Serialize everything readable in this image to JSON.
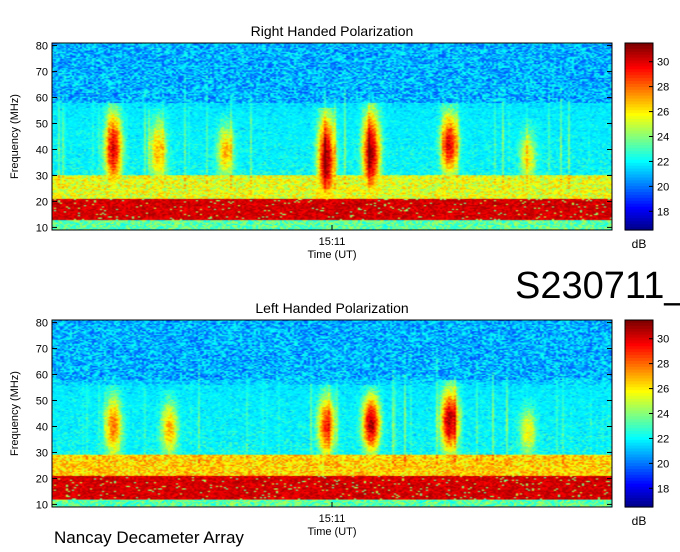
{
  "figure_id": "S230711_",
  "footer": "Nancay Decameter Array",
  "chart_data": [
    {
      "type": "heatmap",
      "title": "Right Handed Polarization",
      "xlabel": "Time (UT)",
      "ylabel": "Frequency (MHz)",
      "x_ticks": [
        "15:11"
      ],
      "ylim": [
        9,
        81
      ],
      "y_ticks": [
        10,
        20,
        30,
        40,
        50,
        60,
        70,
        80
      ],
      "colorbar": {
        "label": "dB",
        "range": [
          16.5,
          31.5
        ],
        "ticks": [
          18,
          20,
          22,
          24,
          26,
          28,
          30
        ],
        "colormap": "jet"
      },
      "features": {
        "background_db": 21,
        "band_strong": {
          "freq": [
            13,
            21
          ],
          "db": 31
        },
        "band_moderate": {
          "freq": [
            21,
            30
          ],
          "db": 26
        },
        "bursts": [
          {
            "t": 0.11,
            "f": [
              28,
              52
            ],
            "db": 30
          },
          {
            "t": 0.19,
            "f": [
              28,
              50
            ],
            "db": 27
          },
          {
            "t": 0.31,
            "f": [
              30,
              48
            ],
            "db": 27
          },
          {
            "t": 0.49,
            "f": [
              22,
              50
            ],
            "db": 31
          },
          {
            "t": 0.57,
            "f": [
              25,
              52
            ],
            "db": 31
          },
          {
            "t": 0.71,
            "f": [
              32,
              52
            ],
            "db": 30
          },
          {
            "t": 0.85,
            "f": [
              28,
              46
            ],
            "db": 26
          }
        ]
      }
    },
    {
      "type": "heatmap",
      "title": "Left Handed Polarization",
      "xlabel": "Time (UT)",
      "ylabel": "Frequency (MHz)",
      "x_ticks": [
        "15:11"
      ],
      "ylim": [
        9,
        81
      ],
      "y_ticks": [
        10,
        20,
        30,
        40,
        50,
        60,
        70,
        80
      ],
      "colorbar": {
        "label": "dB",
        "range": [
          16.5,
          31.5
        ],
        "ticks": [
          18,
          20,
          22,
          24,
          26,
          28,
          30
        ],
        "colormap": "jet"
      },
      "features": {
        "background_db": 21,
        "band_strong": {
          "freq": [
            12,
            21
          ],
          "db": 31
        },
        "band_moderate": {
          "freq": [
            21,
            29
          ],
          "db": 27
        },
        "bursts": [
          {
            "t": 0.11,
            "f": [
              30,
              50
            ],
            "db": 28
          },
          {
            "t": 0.21,
            "f": [
              30,
              48
            ],
            "db": 27
          },
          {
            "t": 0.49,
            "f": [
              30,
              50
            ],
            "db": 29
          },
          {
            "t": 0.57,
            "f": [
              32,
              50
            ],
            "db": 31
          },
          {
            "t": 0.71,
            "f": [
              32,
              52
            ],
            "db": 31
          },
          {
            "t": 0.85,
            "f": [
              30,
              46
            ],
            "db": 26
          }
        ]
      }
    }
  ]
}
